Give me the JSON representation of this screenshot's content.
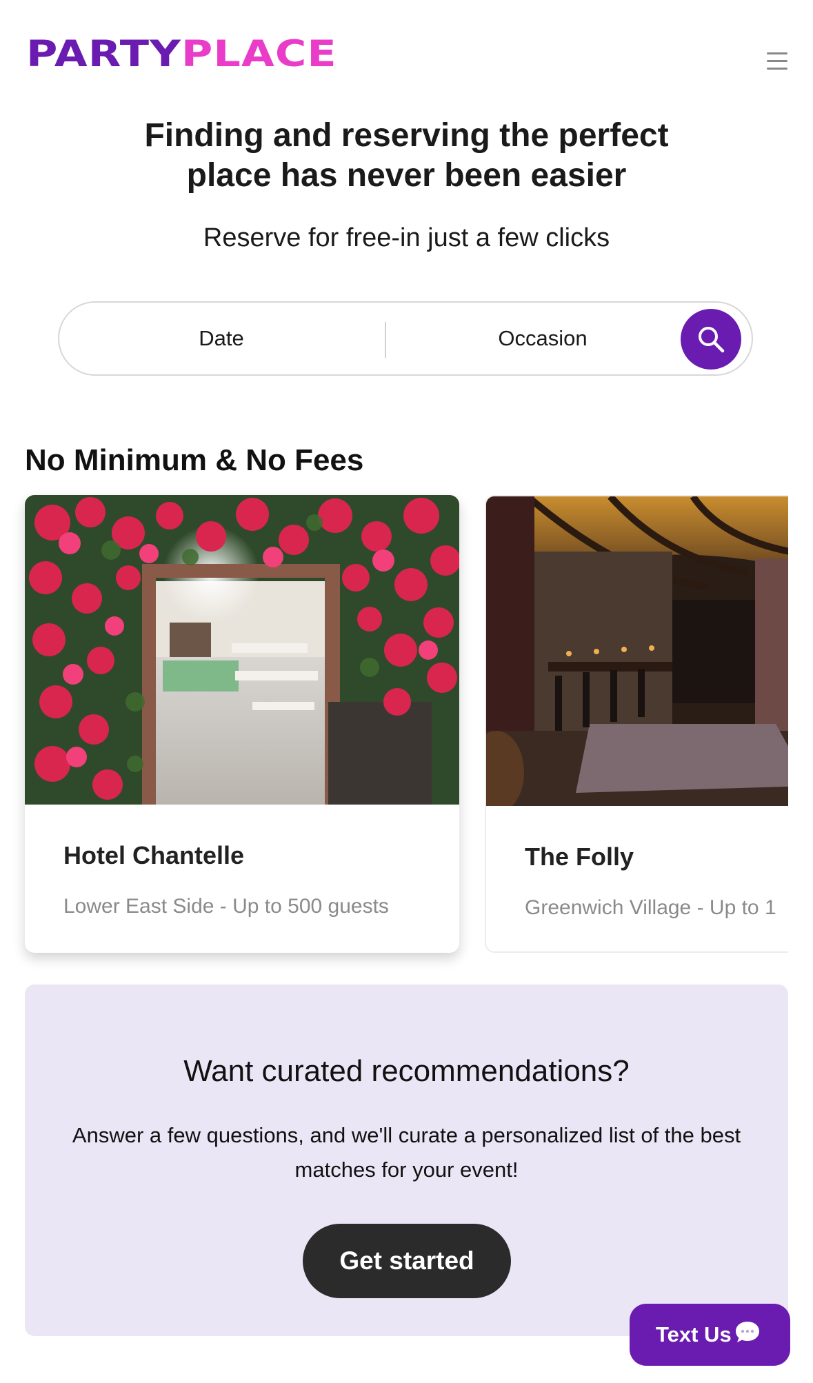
{
  "header": {
    "logo_part": "PARTY",
    "logo_place": "PLACE",
    "menu_icon": "hamburger-menu-icon"
  },
  "hero": {
    "title_line1": "Finding and reserving the perfect",
    "title_line2": "place has never been easier",
    "subtitle": "Reserve for free-in just a few clicks"
  },
  "search": {
    "date_label": "Date",
    "occasion_label": "Occasion",
    "button_icon": "search-icon"
  },
  "section": {
    "title": "No Minimum & No Fees"
  },
  "venues": [
    {
      "name": "Hotel Chantelle",
      "meta": "Lower East Side - Up to 500 guests"
    },
    {
      "name": "The Folly",
      "meta": "Greenwich Village - Up to 1"
    }
  ],
  "recommendations": {
    "title": "Want curated recommendations?",
    "body": "Answer a few questions, and we'll curate a personalized list of the best matches for your event!",
    "button_label": "Get started"
  },
  "text_us": {
    "label": "Text Us",
    "icon": "chat-bubble-icon"
  },
  "colors": {
    "brand_purple": "#6a1bb0",
    "brand_pink": "#e93cc8",
    "panel_bg": "#ebe6f6",
    "dark_button": "#2b2b2b"
  }
}
